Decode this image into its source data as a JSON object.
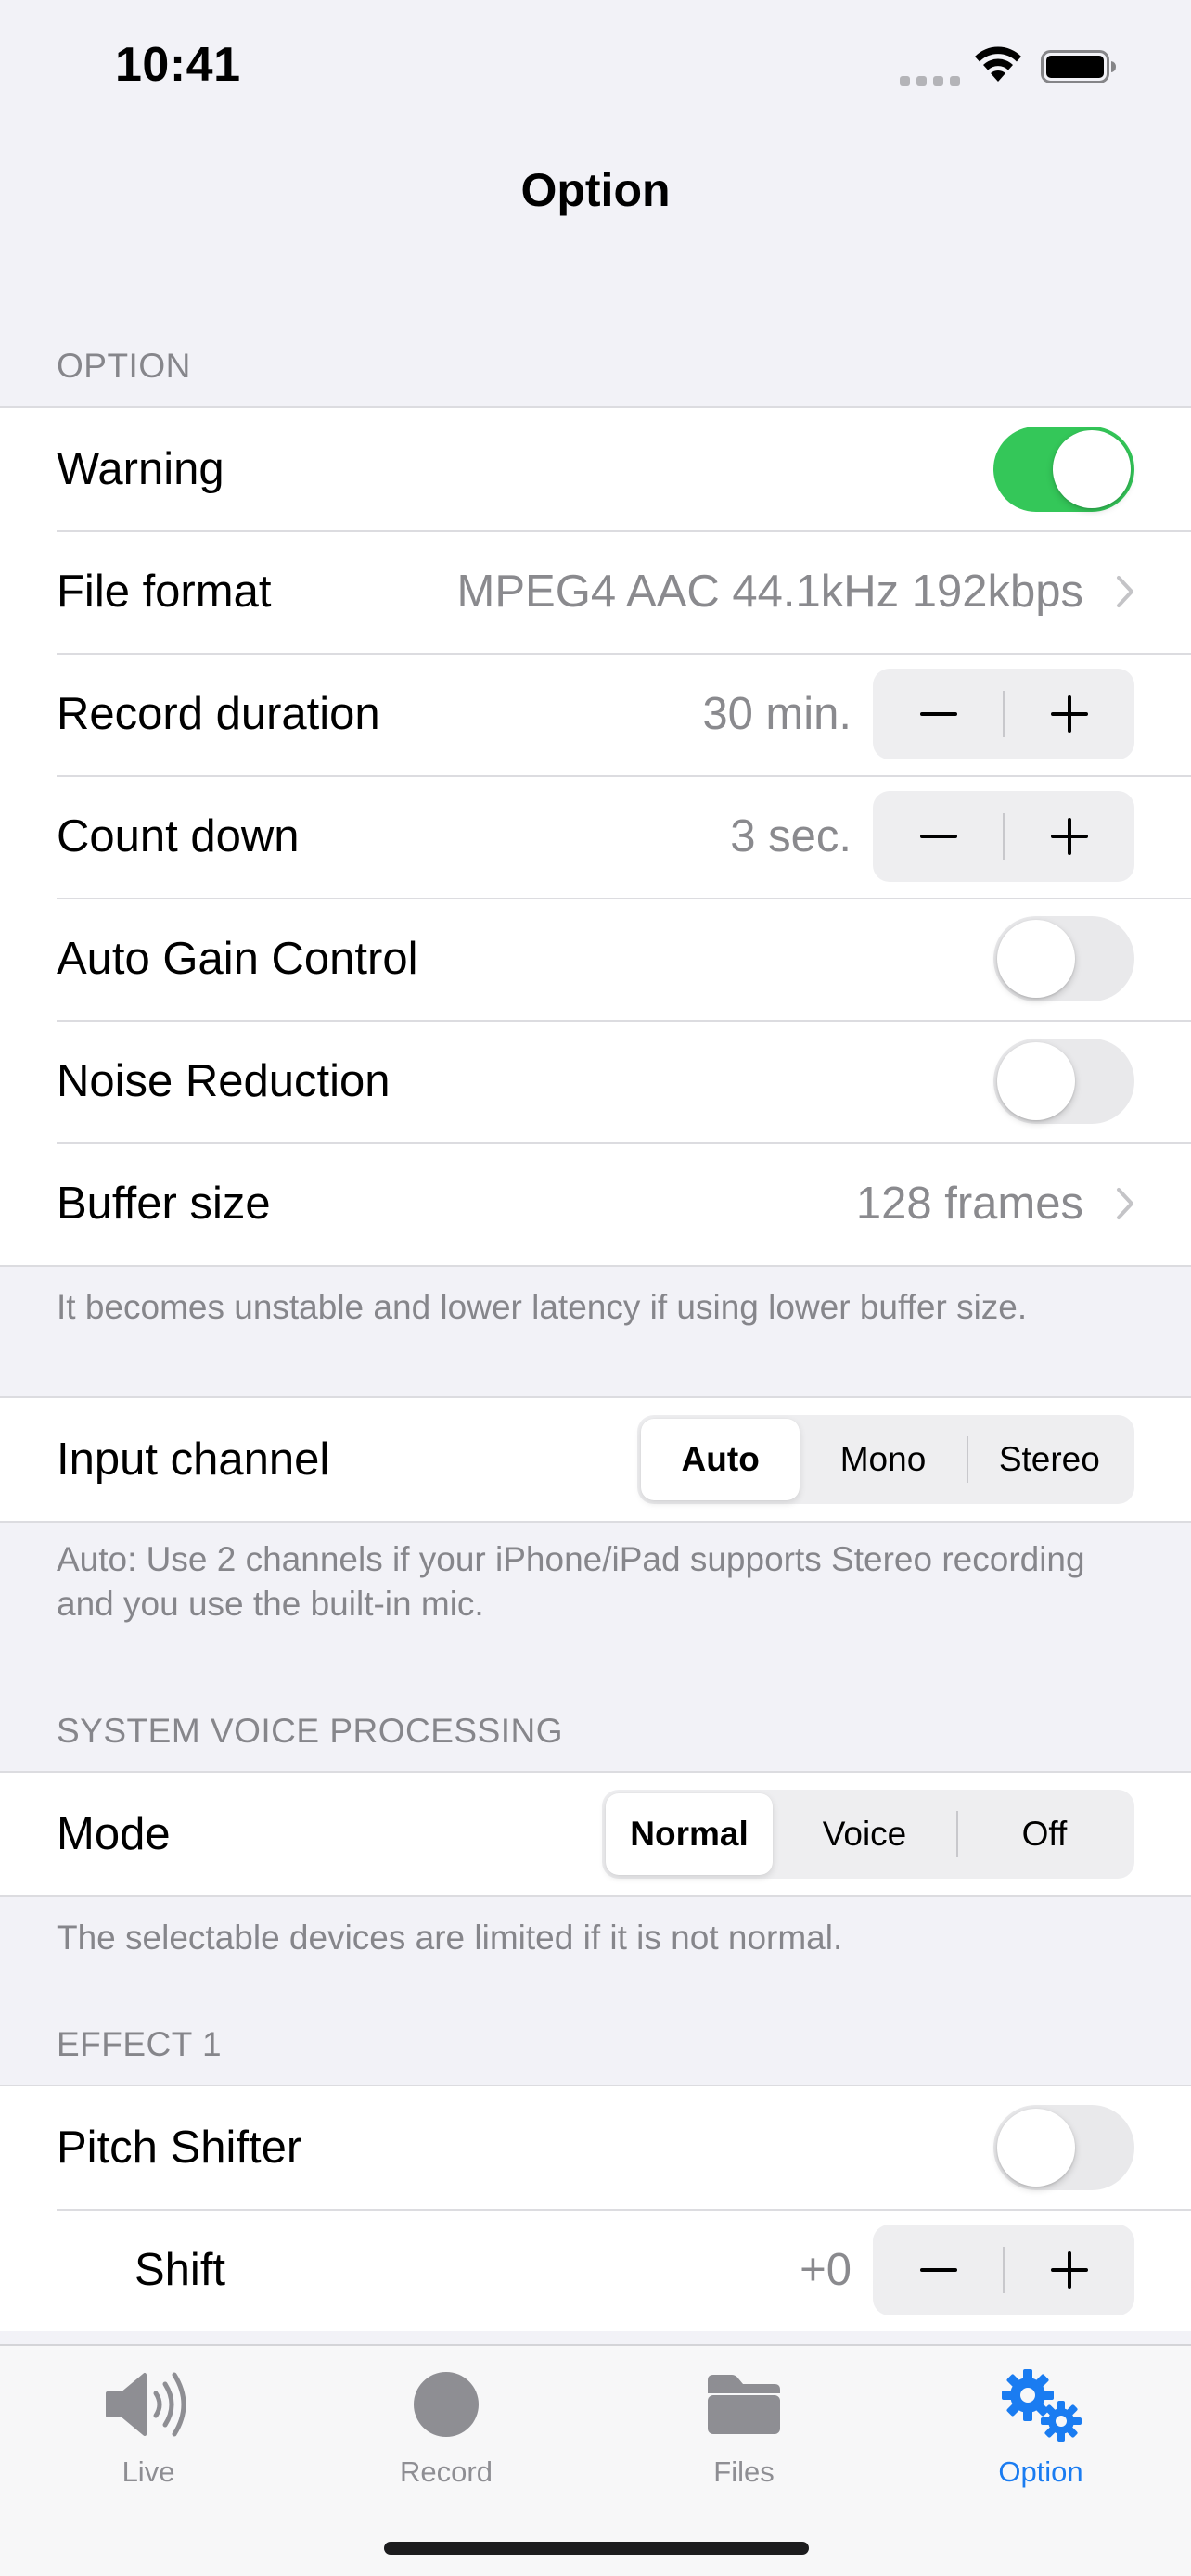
{
  "status_bar": {
    "time": "10:41"
  },
  "nav": {
    "title": "Option"
  },
  "option_section": {
    "header": "OPTION",
    "warning": {
      "label": "Warning",
      "on": true
    },
    "file_format": {
      "label": "File format",
      "value": "MPEG4 AAC 44.1kHz 192kbps"
    },
    "record_duration": {
      "label": "Record duration",
      "value": "30 min."
    },
    "count_down": {
      "label": "Count down",
      "value": "3 sec."
    },
    "auto_gain": {
      "label": "Auto Gain Control",
      "on": false
    },
    "noise_reduction": {
      "label": "Noise Reduction",
      "on": false
    },
    "buffer_size": {
      "label": "Buffer size",
      "value": "128 frames"
    },
    "footer": "It becomes unstable and lower latency if using lower buffer size."
  },
  "input_section": {
    "input_channel": {
      "label": "Input channel",
      "options": [
        "Auto",
        "Mono",
        "Stereo"
      ],
      "selected": "Auto"
    },
    "footer": "Auto: Use 2 channels if your iPhone/iPad supports Stereo recording and you use the built-in mic."
  },
  "voice_section": {
    "header": "SYSTEM VOICE PROCESSING",
    "mode": {
      "label": "Mode",
      "options": [
        "Normal",
        "Voice",
        "Off"
      ],
      "selected": "Normal"
    },
    "footer": "The selectable devices are limited if it is not normal."
  },
  "effect_section": {
    "header": "EFFECT 1",
    "pitch_shifter": {
      "label": "Pitch Shifter",
      "on": false
    },
    "shift": {
      "label": "Shift",
      "value": "+0"
    }
  },
  "tab_bar": {
    "tabs": [
      {
        "label": "Live",
        "icon": "speaker-icon",
        "active": false
      },
      {
        "label": "Record",
        "icon": "record-icon",
        "active": false
      },
      {
        "label": "Files",
        "icon": "folder-icon",
        "active": false
      },
      {
        "label": "Option",
        "icon": "gears-icon",
        "active": true
      }
    ]
  },
  "colors": {
    "accent": "#1A7CF1",
    "toggle_on": "#34C759",
    "background": "#F2F2F7"
  }
}
